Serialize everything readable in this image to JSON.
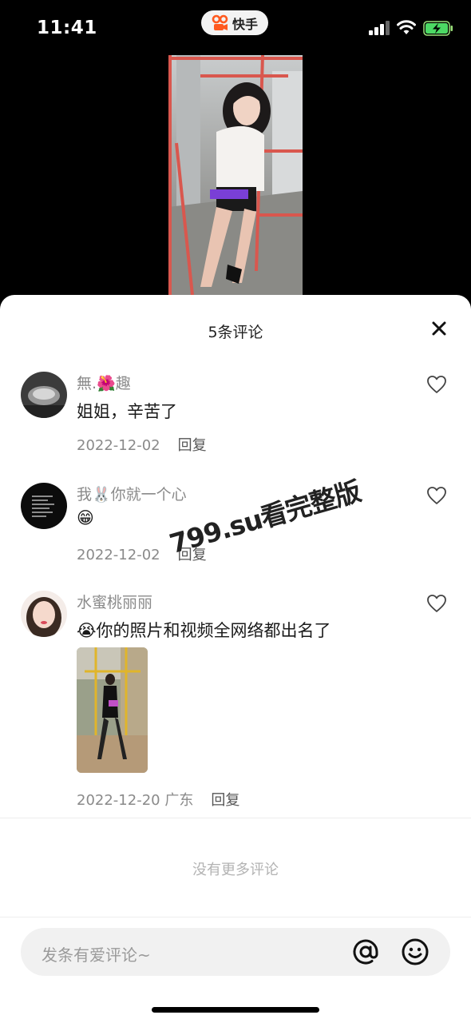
{
  "status_bar": {
    "time": "11:41",
    "app_name": "快手"
  },
  "sheet": {
    "title": "5条评论",
    "comments": [
      {
        "author": "無.🌺趣",
        "text": "姐姐，辛苦了",
        "date": "2022-12-02",
        "reply_label": "回复"
      },
      {
        "author": "我🐰你就一个心",
        "text": "😁",
        "date": "2022-12-02",
        "reply_label": "回复"
      },
      {
        "author": "水蜜桃丽丽",
        "text": "😭你的照片和视频全网络都出名了",
        "date": "2022-12-20",
        "location": "广东",
        "reply_label": "回复"
      }
    ],
    "no_more_text": "没有更多评论"
  },
  "input": {
    "placeholder": "发条有爱评论~"
  },
  "watermark": "799.su看完整版",
  "colors": {
    "brand": "#ff5a1f",
    "text": "#1a1a1a",
    "muted": "#8a8a8a"
  }
}
